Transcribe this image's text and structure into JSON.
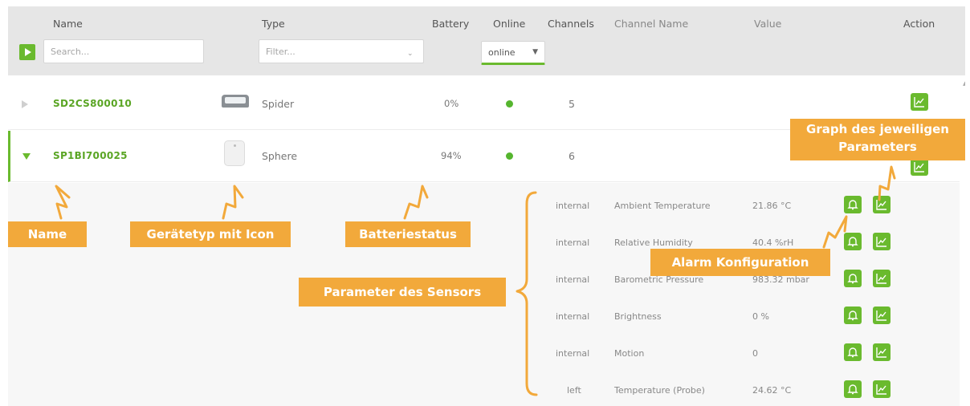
{
  "header": {
    "name_label": "Name",
    "type_label": "Type",
    "battery_label": "Battery",
    "online_label": "Online",
    "channels_label": "Channels",
    "channel_name_label": "Channel Name",
    "value_label": "Value",
    "action_label": "Action",
    "search_placeholder": "Search...",
    "filter_placeholder": "Filter...",
    "online_select_value": "online"
  },
  "devices": [
    {
      "name": "SD2CS800010",
      "type": "Spider",
      "battery": "0%",
      "online": true,
      "channels": "5",
      "expanded": false
    },
    {
      "name": "SP1BI700025",
      "type": "Sphere",
      "battery": "94%",
      "online": true,
      "channels": "6",
      "expanded": true
    }
  ],
  "parameters": [
    {
      "position": "internal",
      "channel_name": "Ambient Temperature",
      "value": "21.86 °C"
    },
    {
      "position": "internal",
      "channel_name": "Relative Humidity",
      "value": "40.4 %rH"
    },
    {
      "position": "internal",
      "channel_name": "Barometric Pressure",
      "value": "983.32 mbar"
    },
    {
      "position": "internal",
      "channel_name": "Brightness",
      "value": "0 %"
    },
    {
      "position": "internal",
      "channel_name": "Motion",
      "value": "0"
    },
    {
      "position": "left",
      "channel_name": "Temperature (Probe)",
      "value": "24.62 °C"
    }
  ],
  "annotations": {
    "name": "Name",
    "device_type": "Gerätetyp mit Icon",
    "battery_status": "Batteriestatus",
    "sensor_params": "Parameter des Sensors",
    "alarm_config": "Alarm Konfiguration",
    "graph_line1": "Graph des jeweiligen",
    "graph_line2": "Parameters"
  },
  "colors": {
    "accent_green": "#6aba2e",
    "online_dot": "#55b52e",
    "annotation_orange": "#f2a93b",
    "header_bg": "#e6e6e6"
  },
  "icons": {
    "play": "play-icon",
    "bell": "bell-icon",
    "graph": "chart-line-icon",
    "spider_device": "spider-device-icon",
    "sphere_device": "sphere-device-icon"
  }
}
